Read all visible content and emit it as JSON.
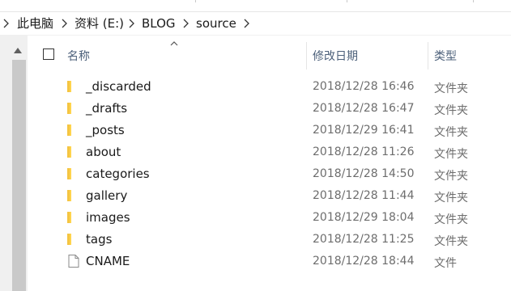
{
  "breadcrumb": {
    "items": [
      "此电脑",
      "资料 (E:)",
      "BLOG",
      "source"
    ]
  },
  "header": {
    "name_label": "名称",
    "date_label": "修改日期",
    "type_label": "类型",
    "sort": "ascending"
  },
  "colors": {
    "folder": "#ffd34d",
    "header_text": "#4c607a",
    "meta_text": "#6d6d6d",
    "scrollbar_track": "#f0f0f0",
    "scrollbar_thumb": "#c9c9c9"
  },
  "files": [
    {
      "name": "_discarded",
      "date": "2018/12/28 16:46",
      "type": "文件夹",
      "icon": "folder-icon"
    },
    {
      "name": "_drafts",
      "date": "2018/12/28 16:47",
      "type": "文件夹",
      "icon": "folder-icon"
    },
    {
      "name": "_posts",
      "date": "2018/12/29 16:41",
      "type": "文件夹",
      "icon": "folder-icon"
    },
    {
      "name": "about",
      "date": "2018/12/28 11:26",
      "type": "文件夹",
      "icon": "folder-icon"
    },
    {
      "name": "categories",
      "date": "2018/12/28 14:50",
      "type": "文件夹",
      "icon": "folder-icon"
    },
    {
      "name": "gallery",
      "date": "2018/12/28 11:44",
      "type": "文件夹",
      "icon": "folder-icon"
    },
    {
      "name": "images",
      "date": "2018/12/29 18:04",
      "type": "文件夹",
      "icon": "folder-icon"
    },
    {
      "name": "tags",
      "date": "2018/12/28 11:25",
      "type": "文件夹",
      "icon": "folder-icon"
    },
    {
      "name": "CNAME",
      "date": "2018/12/28 18:44",
      "type": "文件",
      "icon": "file-icon"
    }
  ]
}
